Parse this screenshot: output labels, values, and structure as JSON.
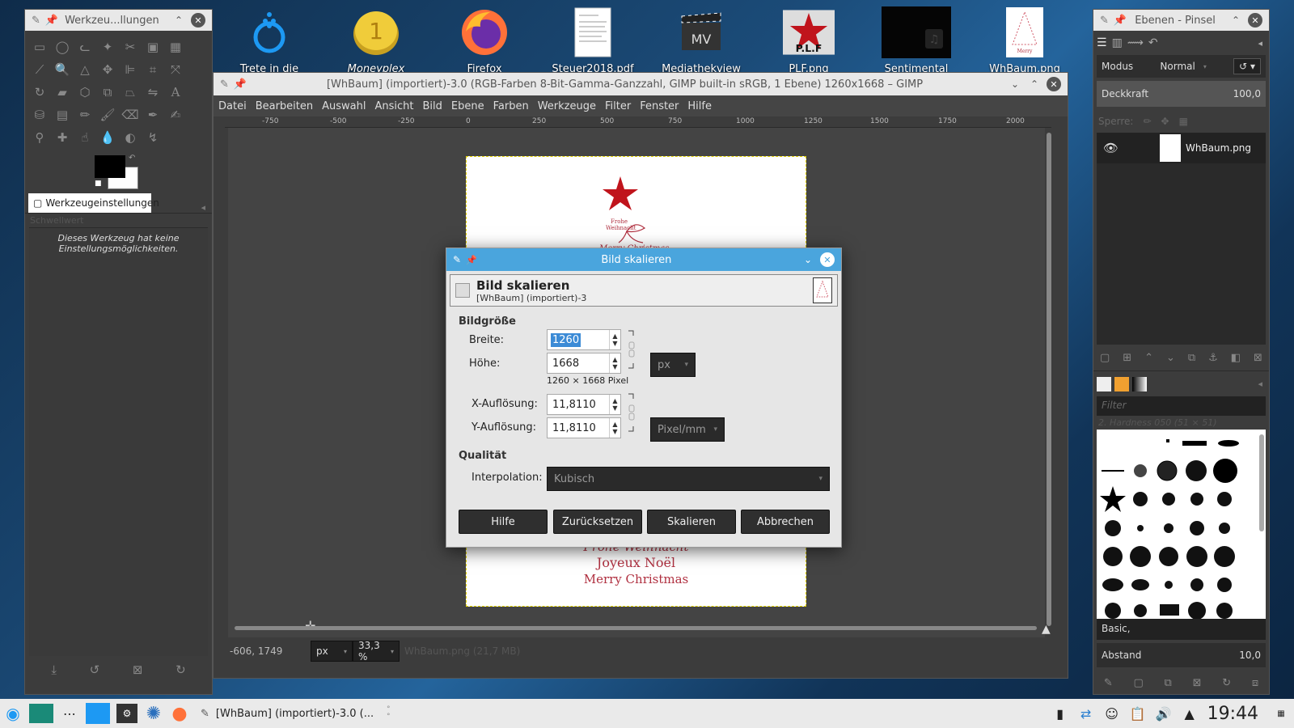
{
  "desktop": {
    "icons": [
      {
        "label": "Trete in die",
        "icon": "kde-community-icon"
      },
      {
        "label": "Moneyplex",
        "icon": "moneyplex-icon"
      },
      {
        "label": "Firefox",
        "icon": "firefox-icon"
      },
      {
        "label": "Steuer2018.pdf",
        "icon": "pdf-document-icon"
      },
      {
        "label": "Mediathekview",
        "icon": "mediathekview-icon"
      },
      {
        "label": "PLF.png",
        "icon": "plf-image-icon"
      },
      {
        "label": "Sentimental",
        "icon": "video-file-icon"
      },
      {
        "label": "WhBaum.png",
        "icon": "christmas-tree-image-icon"
      }
    ]
  },
  "toolbox": {
    "title": "Werkzeu...llungen",
    "tab_label": "Werkzeugeinstellungen",
    "ghost_label": "Schwellwert",
    "message": "Dieses Werkzeug hat keine Einstellungsmöglichkeiten."
  },
  "main_window": {
    "title": "[WhBaum] (importiert)-3.0 (RGB-Farben 8-Bit-Gamma-Ganzzahl, GIMP built-in sRGB, 1 Ebene) 1260x1668 – GIMP",
    "menu": [
      "Datei",
      "Bearbeiten",
      "Auswahl",
      "Ansicht",
      "Bild",
      "Ebene",
      "Farben",
      "Werkzeuge",
      "Filter",
      "Fenster",
      "Hilfe"
    ],
    "ruler_ticks": [
      "-750",
      "-500",
      "-250",
      "0",
      "250",
      "500",
      "750",
      "1000",
      "1250",
      "1500",
      "1750",
      "2000"
    ],
    "status": {
      "coords": "-606, 1749",
      "unit": "px",
      "zoom": "33,3 %",
      "file_info": "WhBaum.png (21,7 MB)"
    },
    "card_text": [
      "Frohe Weihnacht",
      "Joyeux Noël",
      "Merry Christmas"
    ]
  },
  "dialog": {
    "title": "Bild skalieren",
    "heading": "Bild skalieren",
    "subheading": "[WhBaum] (importiert)-3",
    "section_size": "Bildgröße",
    "width_label": "Breite:",
    "width_value": "1260",
    "height_label": "Höhe:",
    "height_value": "1668",
    "size_info": "1260 × 1668 Pixel",
    "unit_size": "px",
    "xres_label": "X-Auflösung:",
    "xres_value": "11,8110",
    "yres_label": "Y-Auflösung:",
    "yres_value": "11,8110",
    "unit_res": "Pixel/mm",
    "section_quality": "Qualität",
    "interp_label": "Interpolation:",
    "interp_value": "Kubisch",
    "buttons": {
      "help": "Hilfe",
      "reset": "Zurücksetzen",
      "scale": "Skalieren",
      "cancel": "Abbrechen"
    }
  },
  "layers_dock": {
    "title": "Ebenen - Pinsel",
    "mode_label": "Modus",
    "mode_value": "Normal",
    "opacity_label": "Deckkraft",
    "opacity_value": "100,0",
    "lock_label": "Sperre:",
    "layer_name": "WhBaum.png"
  },
  "brushes_dock": {
    "filter_placeholder": "Filter",
    "brush_name": "2. Hardness 050 (51 × 51)",
    "tag": "Basic,",
    "spacing_label": "Abstand",
    "spacing_value": "10,0"
  },
  "taskbar": {
    "task_label": "[WhBaum] (importiert)-3.0 (...",
    "clock": "19:44"
  },
  "colors": {
    "accent": "#4aa5dd",
    "dialog_bg": "#e6e6e6",
    "gimp_dark": "#3c3c3c"
  }
}
